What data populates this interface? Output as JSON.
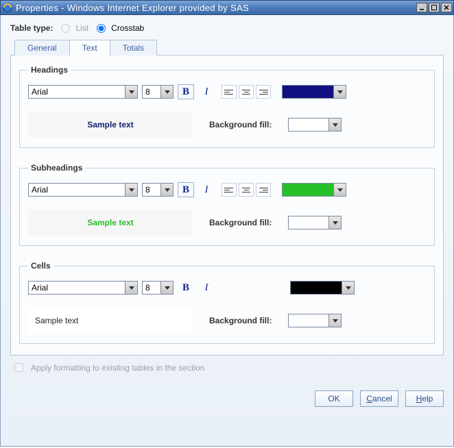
{
  "window": {
    "title": "Properties - Windows Internet Explorer provided by SAS"
  },
  "tableType": {
    "label": "Table type:",
    "options": {
      "list": "List",
      "crosstab": "Crosstab"
    },
    "selected": "crosstab"
  },
  "tabs": {
    "general": "General",
    "text": "Text",
    "totals": "Totals",
    "active": "text"
  },
  "groups": {
    "headings": {
      "legend": "Headings",
      "font": "Arial",
      "size": "8",
      "textColor": "#101080",
      "sample": "Sample text",
      "bgLabel": "Background fill:"
    },
    "subheadings": {
      "legend": "Subheadings",
      "font": "Arial",
      "size": "8",
      "textColor": "#28c028",
      "sample": "Sample text",
      "bgLabel": "Background fill:"
    },
    "cells": {
      "legend": "Cells",
      "font": "Arial",
      "size": "8",
      "textColor": "#000000",
      "sample": "Sample text",
      "bgLabel": "Background fill:"
    }
  },
  "applyExisting": {
    "label": "Apply formatting to existing tables in the section",
    "checked": false,
    "enabled": false
  },
  "buttons": {
    "ok": "OK",
    "cancel": "Cancel",
    "help": "Help"
  }
}
